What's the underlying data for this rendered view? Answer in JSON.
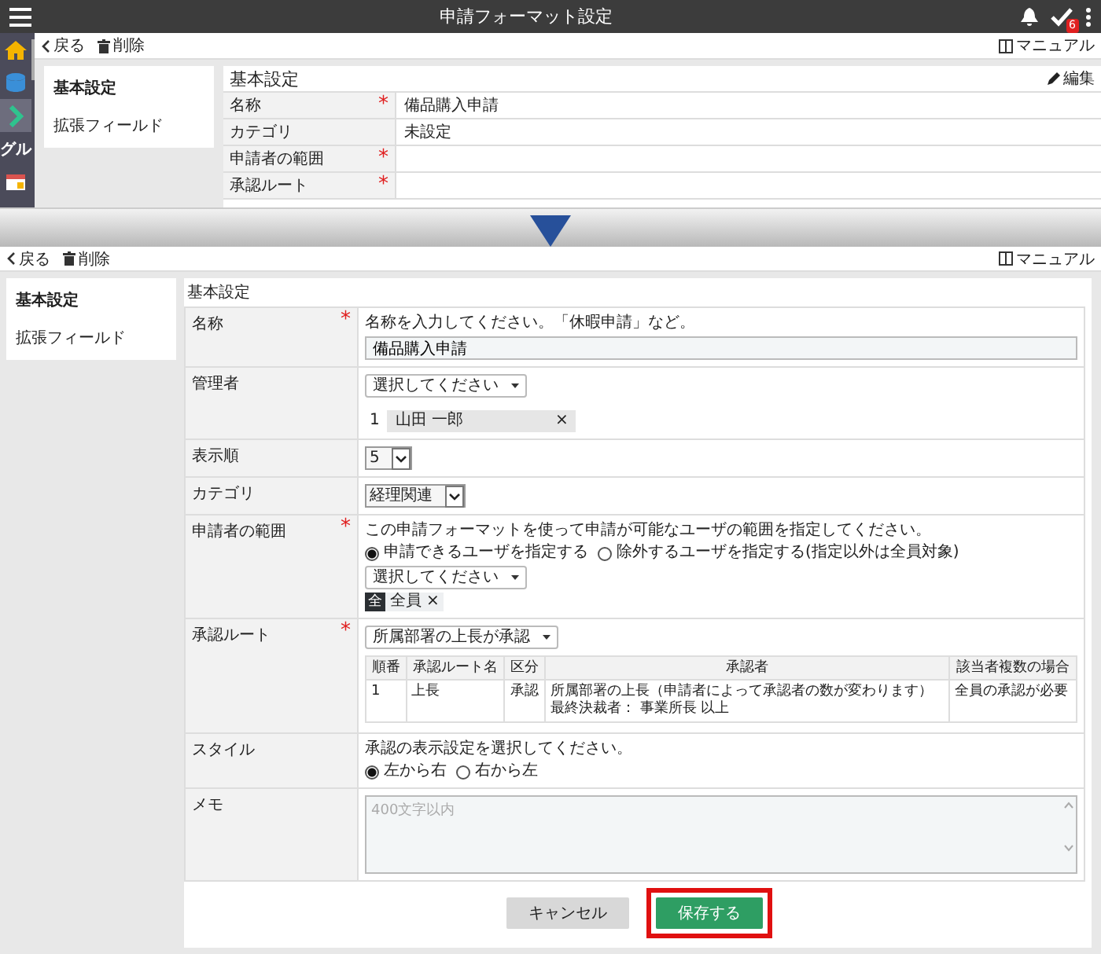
{
  "app_bar": {
    "title": "申請フォーマット設定",
    "badge": "6"
  },
  "before": {
    "nav_rail": [
      {
        "kind": "home",
        "selected": false
      },
      {
        "kind": "database",
        "selected": false
      },
      {
        "kind": "chevron",
        "selected": true
      },
      {
        "kind": "text",
        "label": "グル",
        "selected": false
      },
      {
        "kind": "calendar",
        "selected": false
      }
    ],
    "toolbar": {
      "back": "戻る",
      "delete": "削除",
      "manual": "マニュアル"
    },
    "tabs": [
      {
        "label": "基本設定",
        "selected": true
      },
      {
        "label": "拡張フィールド",
        "selected": false
      }
    ],
    "panel": {
      "title": "基本設定",
      "edit": "編集",
      "rows": [
        {
          "label": "名称",
          "required_mark": "*",
          "value": "備品購入申請"
        },
        {
          "label": "カテゴリ",
          "value": "未設定"
        },
        {
          "label": "申請者の範囲",
          "required_mark": "*"
        },
        {
          "label": "承認ルート",
          "required_mark": "*"
        }
      ]
    }
  },
  "after": {
    "toolbar": {
      "back": "戻る",
      "delete": "削除",
      "manual": "マニュアル"
    },
    "tabs": [
      {
        "label": "基本設定",
        "selected": true
      },
      {
        "label": "拡張フィールド",
        "selected": false
      }
    ],
    "form": {
      "title": "基本設定",
      "fields": [
        {
          "kind": "text",
          "label": "名称",
          "required_mark": "*",
          "hint": "名称を入力してください。「休暇申請」など。",
          "value": "備品購入申請"
        },
        {
          "kind": "select_list",
          "label": "管理者",
          "select": "選択してください",
          "items": [
            {
              "number": "1",
              "name": "山田 一郎",
              "remove": "×"
            }
          ]
        },
        {
          "kind": "small_select",
          "label": "表示順",
          "value": "5"
        },
        {
          "kind": "small_select",
          "label": "カテゴリ",
          "value": "経理関連"
        },
        {
          "kind": "scope",
          "label": "申請者の範囲",
          "required_mark": "*",
          "hint": "この申請フォーマットを使って申請が可能なユーザの範囲を指定してください。",
          "options": [
            {
              "label": "申請できるユーザを指定する",
              "selected": true
            },
            {
              "label": "除外するユーザを指定する(指定以外は全員対象)",
              "selected": false
            }
          ],
          "select": "選択してください",
          "tags": [
            {
              "mark": "全",
              "label": "全員",
              "remove": "×"
            }
          ]
        },
        {
          "kind": "route",
          "label": "承認ルート",
          "required_mark": "*",
          "select": "所属部署の上長が承認",
          "table": {
            "columns": [
              "順番",
              "承認ルート名",
              "区分",
              "承認者",
              "該当者複数の場合"
            ],
            "rows": [
              {
                "cells": [
                  "1",
                  "上長",
                  "承認",
                  [
                    "所属部署の上長（申請者によって承認者の数が変わります）",
                    "最終決裁者： 事業所長 以上"
                  ],
                  "全員の承認が必要"
                ]
              }
            ]
          }
        },
        {
          "kind": "radios",
          "label": "スタイル",
          "hint": "承認の表示設定を選択してください。",
          "options": [
            {
              "label": "左から右",
              "selected": true
            },
            {
              "label": "右から左",
              "selected": false
            }
          ]
        },
        {
          "kind": "textarea",
          "label": "メモ",
          "placeholder": "400文字以内"
        }
      ]
    },
    "buttons": [
      {
        "label": "キャンセル",
        "kind": "secondary",
        "highlighted": false
      },
      {
        "label": "保存する",
        "kind": "primary",
        "highlighted": true
      }
    ]
  }
}
